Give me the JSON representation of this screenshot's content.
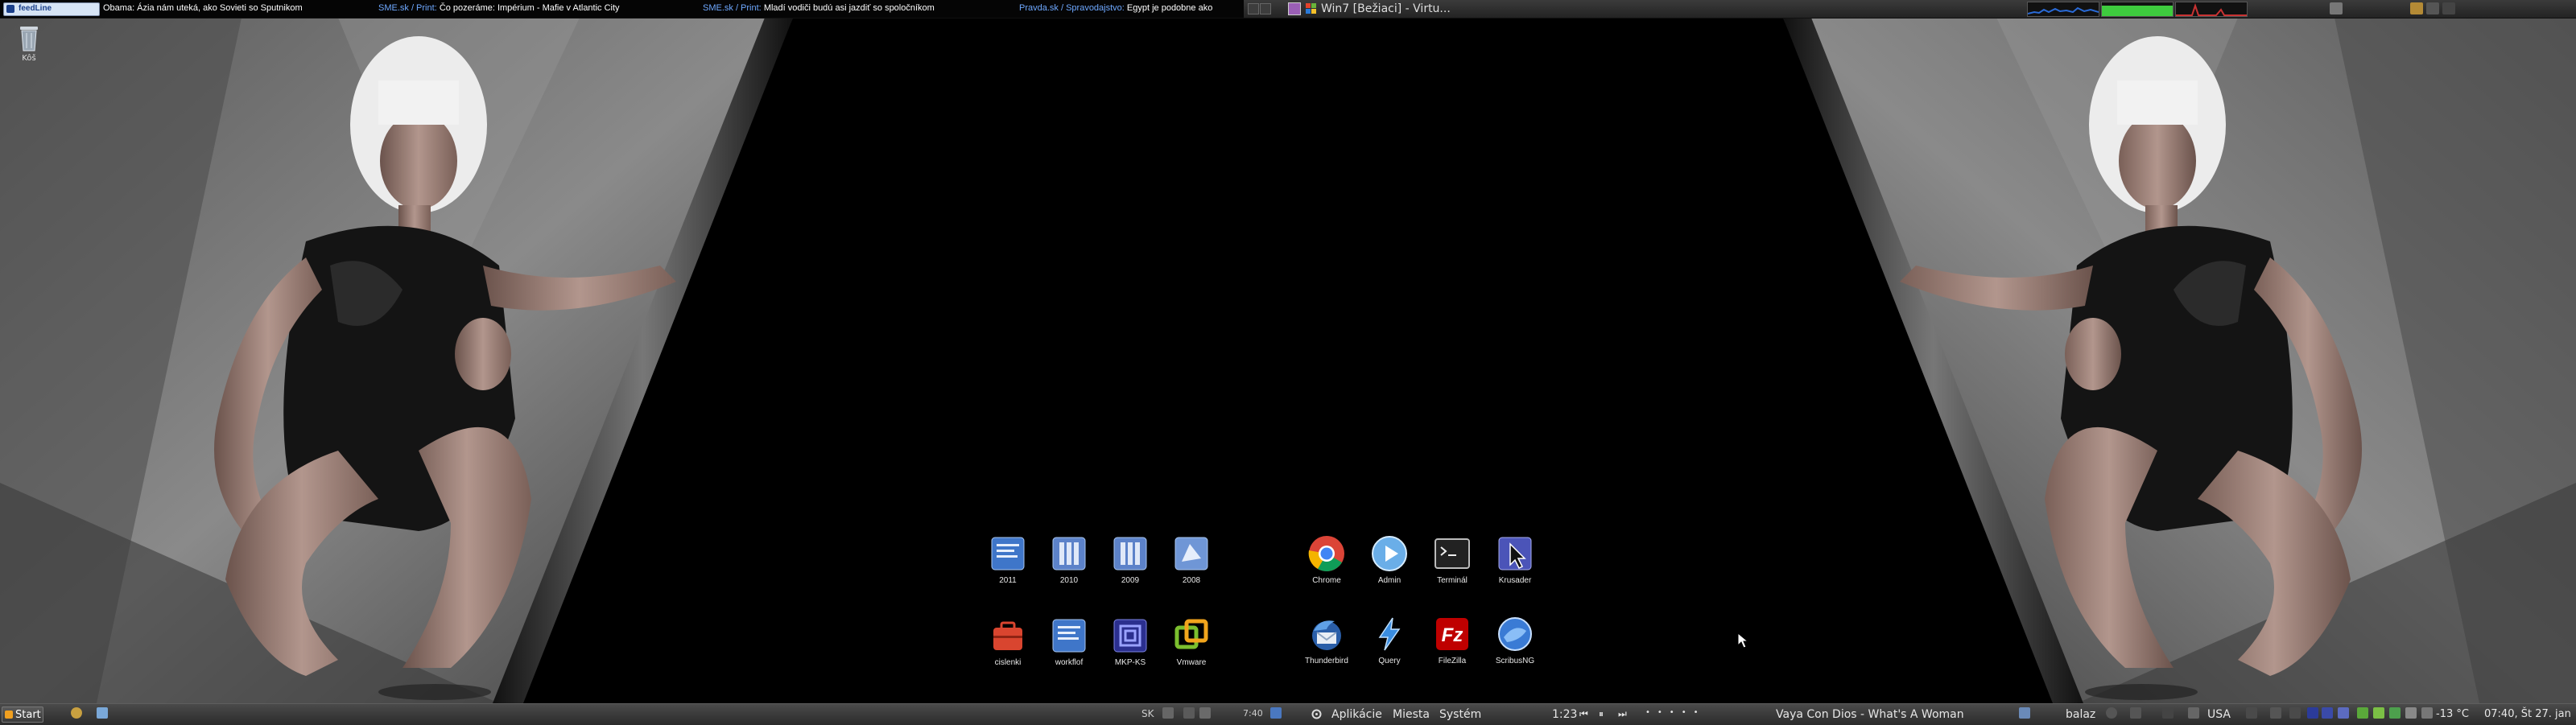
{
  "top_panel": {
    "ticker_logo": "feedLine",
    "ticker_items": [
      {
        "source": "",
        "headline": "Obama: Ázia nám uteká, ako Sovieti so Sputnikom"
      },
      {
        "source": "SME.sk / Print:",
        "headline": "Čo pozeráme: Impérium - Mafie v Atlantic City"
      },
      {
        "source": "SME.sk / Print:",
        "headline": "Mladí vodiči budú asi jazdiť so spoločníkom"
      },
      {
        "source": "Pravda.sk / Spravodajstvo:",
        "headline": "Egypt je podobne ako"
      }
    ],
    "window_title": "Win7 [Bežiaci] - Virtu..."
  },
  "desktop": {
    "trash_label": "Kôš",
    "left_group": [
      {
        "label": "2011",
        "icon": "folder-doc-icon"
      },
      {
        "label": "2010",
        "icon": "folder-doc-icon"
      },
      {
        "label": "2009",
        "icon": "folder-doc-icon"
      },
      {
        "label": "2008",
        "icon": "folder-doc-icon"
      },
      {
        "label": "cislenki",
        "icon": "toolbox-icon"
      },
      {
        "label": "workflof",
        "icon": "workflow-icon"
      },
      {
        "label": "MKP-KS",
        "icon": "mkp-icon"
      },
      {
        "label": "Vmware",
        "icon": "vmware-icon"
      }
    ],
    "right_group": [
      {
        "label": "Chrome",
        "icon": "chrome-icon"
      },
      {
        "label": "Admin",
        "icon": "admin-icon"
      },
      {
        "label": "Terminál",
        "icon": "terminal-icon"
      },
      {
        "label": "Krusader",
        "icon": "krusader-icon"
      },
      {
        "label": "Thunderbird",
        "icon": "thunderbird-icon"
      },
      {
        "label": "Query",
        "icon": "query-icon"
      },
      {
        "label": "FileZilla",
        "icon": "filezilla-icon"
      },
      {
        "label": "ScribusNG",
        "icon": "scribus-icon"
      }
    ]
  },
  "bottom_panel": {
    "start_label": "Start",
    "lang_left": "SK",
    "clock_left": "7:40",
    "menu_apps": "Aplikácie",
    "menu_places": "Miesta",
    "menu_system": "Systém",
    "player_time": "1:23",
    "now_playing": "Vaya Con Dios - What's A Woman",
    "user": "balaz",
    "keyboard_layout": "USA",
    "weather": "-13 °C",
    "datetime": "07:40, Št 27. jan"
  },
  "colors": {
    "ticker_source": "#6ea8ff",
    "panel_bg": "#2b2b2b",
    "graph_net": "#2a6bd8",
    "graph_mem": "#3ecb3e",
    "graph_load": "#c83232"
  }
}
